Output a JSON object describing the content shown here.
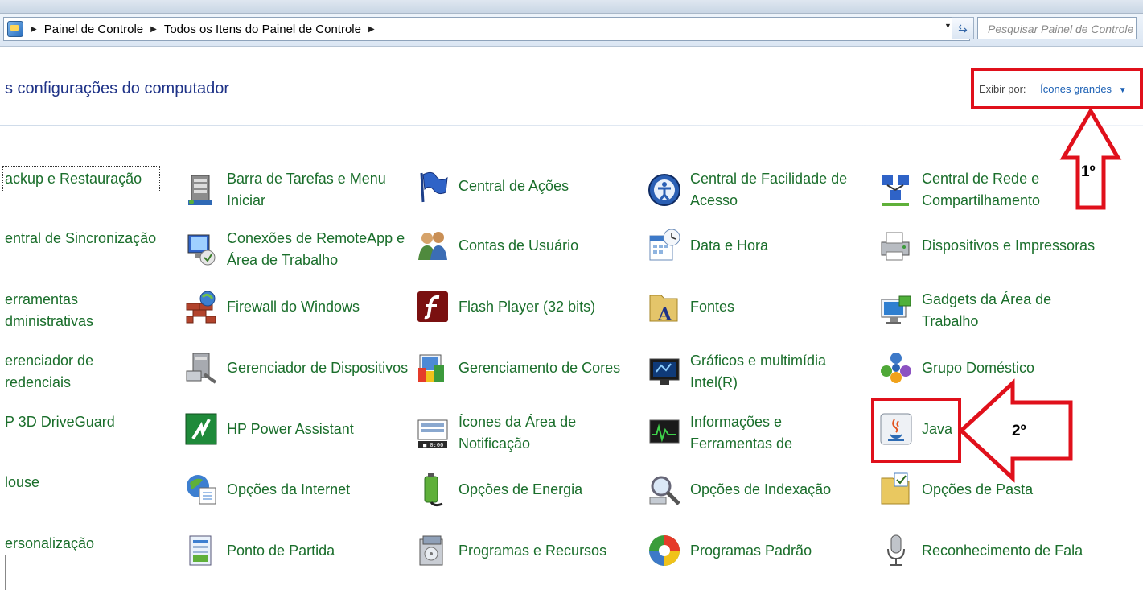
{
  "addressbar": {
    "crumbs": [
      "Painel de Controle",
      "Todos os Itens do Painel de Controle"
    ],
    "search_placeholder": "Pesquisar Painel de Controle"
  },
  "header": {
    "title": "s configurações do computador",
    "view_by_label": "Exibir por:",
    "view_by_value": "Ícones grandes"
  },
  "annotations": {
    "step1": "1º",
    "step2": "2º",
    "color": "#e0101b"
  },
  "items": [
    {
      "label": "ackup e Restauração",
      "icon": "backup-icon"
    },
    {
      "label": "Barra de Tarefas e Menu Iniciar",
      "icon": "taskbar-icon"
    },
    {
      "label": "Central de Ações",
      "icon": "action-center-flag-icon"
    },
    {
      "label": "Central de Facilidade de Acesso",
      "icon": "ease-of-access-icon"
    },
    {
      "label": "Central de Rede e Compartilhamento",
      "icon": "network-icon"
    },
    {
      "label": "entral de Sincronização",
      "icon": "sync-icon"
    },
    {
      "label": "Conexões de RemoteApp e Área de Trabalho",
      "icon": "remoteapp-icon"
    },
    {
      "label": "Contas de Usuário",
      "icon": "users-icon"
    },
    {
      "label": "Data e Hora",
      "icon": "calendar-clock-icon"
    },
    {
      "label": "Dispositivos e Impressoras",
      "icon": "printer-icon"
    },
    {
      "label": "erramentas\ndministrativas",
      "icon": "admin-tools-icon"
    },
    {
      "label": "Firewall do Windows",
      "icon": "firewall-icon"
    },
    {
      "label": "Flash Player (32 bits)",
      "icon": "flash-icon"
    },
    {
      "label": "Fontes",
      "icon": "fonts-folder-icon"
    },
    {
      "label": "Gadgets da Área de Trabalho",
      "icon": "gadgets-icon"
    },
    {
      "label": "erenciador de\nredenciais",
      "icon": "credential-icon"
    },
    {
      "label": "Gerenciador de Dispositivos",
      "icon": "device-manager-icon"
    },
    {
      "label": "Gerenciamento de Cores",
      "icon": "color-management-icon"
    },
    {
      "label": "Gráficos e multimídia Intel(R)",
      "icon": "intel-graphics-icon"
    },
    {
      "label": "Grupo Doméstico",
      "icon": "homegroup-icon"
    },
    {
      "label": "P 3D DriveGuard",
      "icon": "hp-driveguard-icon"
    },
    {
      "label": "HP Power Assistant",
      "icon": "hp-power-icon"
    },
    {
      "label": "Ícones da Área de Notificação",
      "icon": "notification-icons-icon"
    },
    {
      "label": "Informações e Ferramentas de",
      "icon": "performance-icon"
    },
    {
      "label": "Java",
      "icon": "java-icon"
    },
    {
      "label": "louse",
      "icon": "mouse-icon"
    },
    {
      "label": "Opções da Internet",
      "icon": "internet-options-icon"
    },
    {
      "label": "Opções de Energia",
      "icon": "power-options-icon"
    },
    {
      "label": "Opções de Indexação",
      "icon": "indexing-icon"
    },
    {
      "label": "Opções de Pasta",
      "icon": "folder-options-icon"
    },
    {
      "label": "ersonalização",
      "icon": "personalization-icon"
    },
    {
      "label": "Ponto de Partida",
      "icon": "getting-started-icon"
    },
    {
      "label": "Programas e Recursos",
      "icon": "programs-icon"
    },
    {
      "label": "Programas Padrão",
      "icon": "default-programs-icon"
    },
    {
      "label": "Reconhecimento de Fala",
      "icon": "microphone-icon"
    }
  ]
}
